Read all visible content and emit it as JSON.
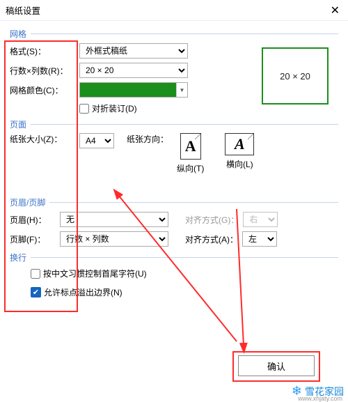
{
  "title": "稿纸设置",
  "grid": {
    "header": "网格",
    "format_label": "格式(S)：",
    "format_value": "外框式稿纸",
    "rowcol_label": "行数×列数(R)：",
    "rowcol_value": "20 × 20",
    "color_label": "网格颜色(C)：",
    "color_hex": "#1b8f1b",
    "fold_label": "对折装订(D)",
    "preview_text": "20 × 20"
  },
  "page": {
    "header": "页面",
    "size_label": "纸张大小(Z)：",
    "size_value": "A4",
    "orient_label": "纸张方向：",
    "portrait_label": "纵向(T)",
    "landscape_label": "横向(L)",
    "glyph": "A"
  },
  "headerfooter": {
    "header": "页眉/页脚",
    "hdr_label": "页眉(H)：",
    "hdr_value": "无",
    "hdr_align_label": "对齐方式(G)：",
    "hdr_align_value": "右",
    "ftr_label": "页脚(F)：",
    "ftr_value": "行数 × 列数",
    "ftr_align_label": "对齐方式(A)：",
    "ftr_align_value": "左"
  },
  "wrap": {
    "header": "换行",
    "cjk_label": "按中文习惯控制首尾字符(U)",
    "overflow_label": "允许标点溢出边界(N)"
  },
  "buttons": {
    "ok": "确认"
  },
  "watermark": {
    "text": "雪花家园",
    "url": "www.xhjaty.com"
  }
}
